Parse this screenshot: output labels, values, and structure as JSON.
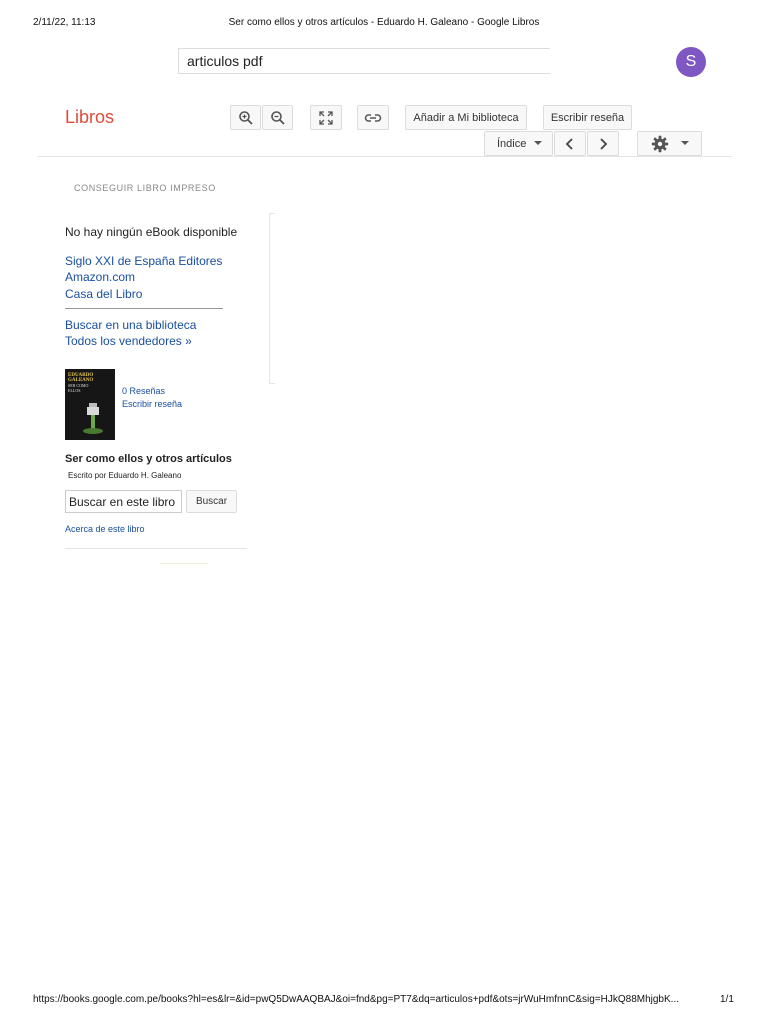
{
  "print": {
    "datetime": "2/11/22, 11:13",
    "title": "Ser como ellos y otros artículos - Eduardo H. Galeano - Google Libros",
    "url": "https://books.google.com.pe/books?hl=es&lr=&id=pwQ5DwAAQBAJ&oi=fnd&pg=PT7&dq=articulos+pdf&ots=jrWuHmfnnC&sig=HJkQ88MhjgbK...",
    "page_number": "1/1"
  },
  "header": {
    "search_value": "articulos pdf",
    "avatar_letter": "S"
  },
  "brand": "Libros",
  "toolbar": {
    "add_library": "Añadir a Mi biblioteca",
    "write_review": "Escribir reseña",
    "index": "Índice"
  },
  "sidebar": {
    "heading": "CONSEGUIR LIBRO IMPRESO",
    "no_ebook": "No hay ningún eBook disponible",
    "sellers": [
      "Siglo XXI de España Editores",
      "Amazon.com",
      "Casa del Libro"
    ],
    "library_link": "Buscar en una biblioteca",
    "all_sellers": "Todos los vendedores »",
    "cover": {
      "author": "EDUARDO GALEANO",
      "title": "SER COMO ELLOS"
    },
    "reviews_count": "0 Reseñas",
    "write_review": "Escribir reseña",
    "book_title": "Ser como ellos y otros artículos",
    "book_author": "Escrito por Eduardo H. Galeano",
    "search_in_book_value": "Buscar en este libro",
    "search_button": "Buscar",
    "about_link": "Acerca de este libro"
  },
  "colors": {
    "brand_red": "#dd4b39",
    "link_blue": "#1a4fa0",
    "avatar_purple": "#7e57c2"
  }
}
